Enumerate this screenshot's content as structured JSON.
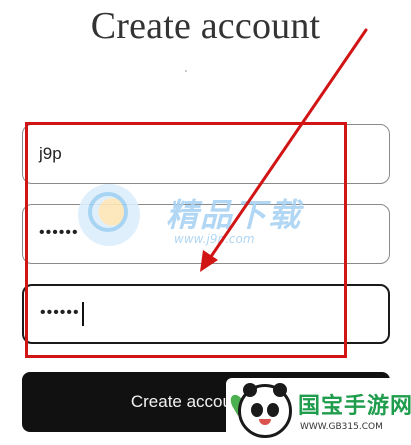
{
  "title": "Create account",
  "fields": [
    {
      "value": "j9p"
    },
    {
      "value": "••••••"
    },
    {
      "value": "••••••"
    }
  ],
  "submit_label": "Create account",
  "colors": {
    "annotation": "#d11414",
    "button": "#111111",
    "field_border": "#8a8a8a"
  },
  "watermarks": {
    "center_title": "精品下载",
    "center_url": "www.j9p.com",
    "corner_title": "国宝手游网",
    "corner_url": "WWW.GB315.COM"
  }
}
